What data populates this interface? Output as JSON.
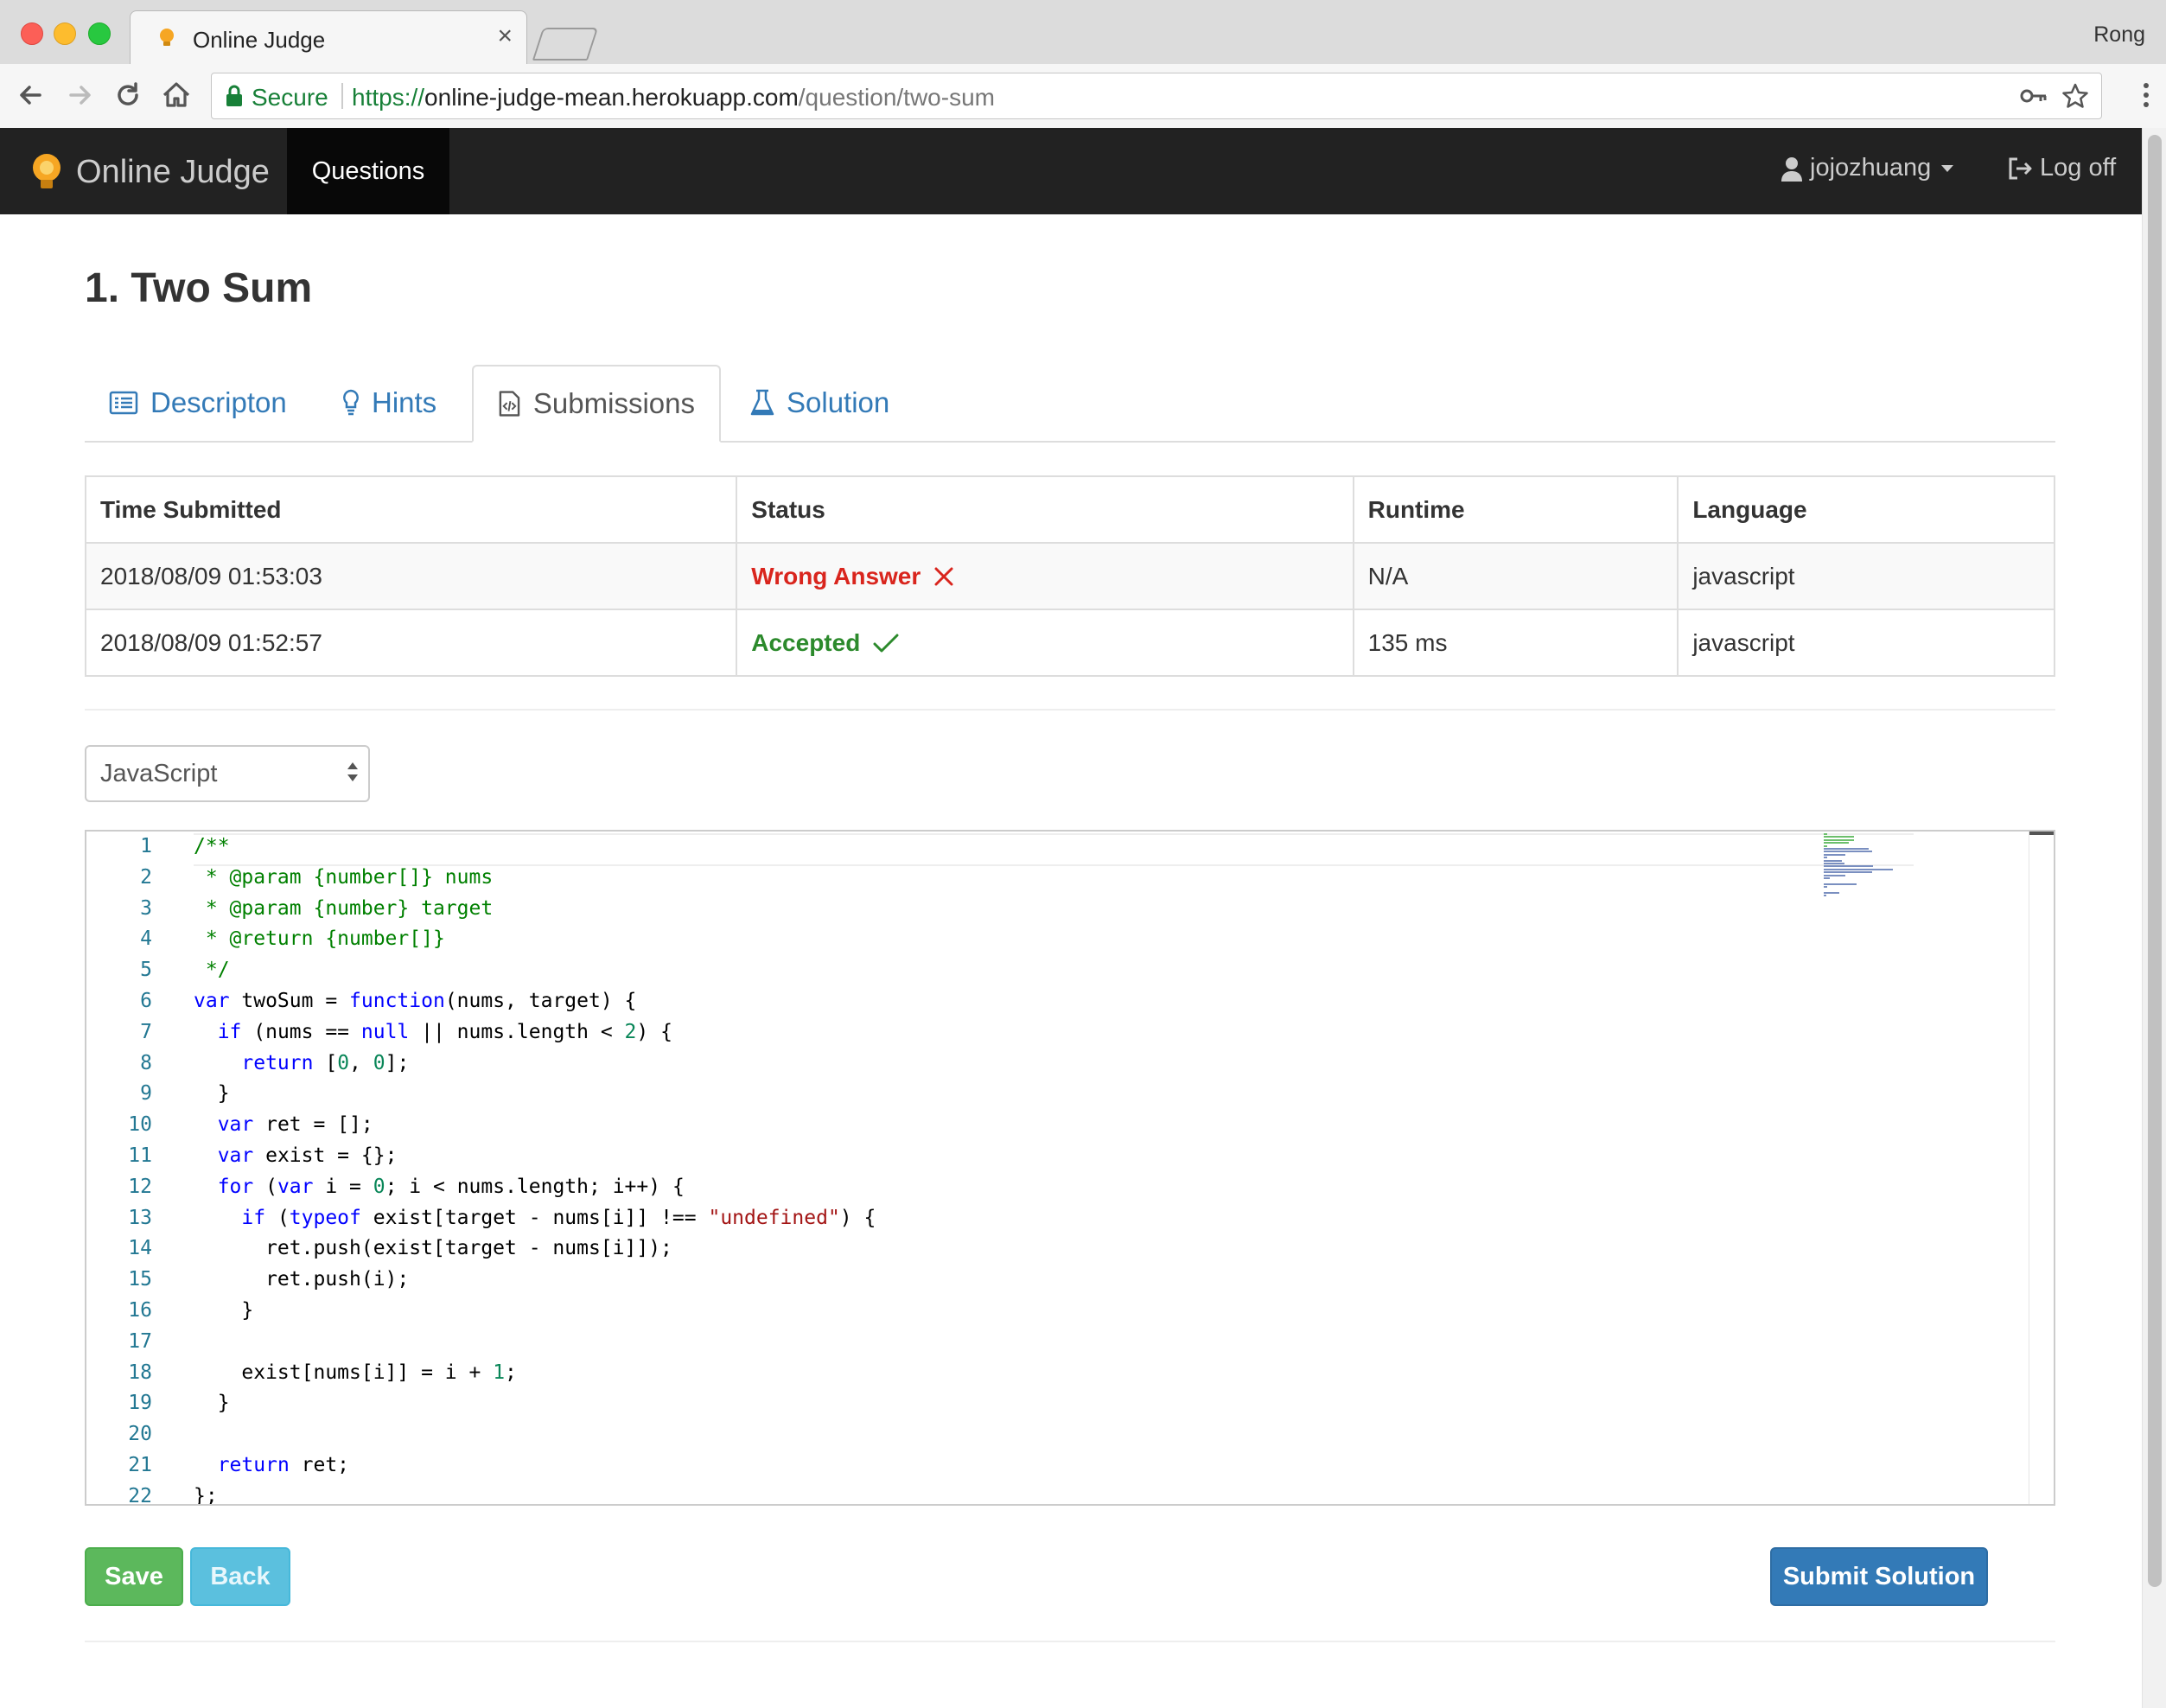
{
  "browser": {
    "tab_title": "Online Judge",
    "profile": "Rong",
    "secure_label": "Secure",
    "url_scheme": "https://",
    "url_host": "online-judge-mean.herokuapp.com",
    "url_path": "/question/two-sum"
  },
  "navbar": {
    "brand": "Online Judge",
    "questions": "Questions",
    "user": "jojozhuang",
    "logoff": "Log off"
  },
  "page": {
    "title": "1. Two Sum"
  },
  "tabs": [
    {
      "label": "Descripton",
      "icon": "list-alt-icon"
    },
    {
      "label": "Hints",
      "icon": "lightbulb-icon"
    },
    {
      "label": "Submissions",
      "icon": "code-file-icon",
      "active": true
    },
    {
      "label": "Solution",
      "icon": "flask-icon"
    }
  ],
  "submissions": {
    "headers": [
      "Time Submitted",
      "Status",
      "Runtime",
      "Language"
    ],
    "rows": [
      {
        "time": "2018/08/09 01:53:03",
        "status": "Wrong Answer",
        "status_type": "wrong",
        "runtime": "N/A",
        "language": "javascript"
      },
      {
        "time": "2018/08/09 01:52:57",
        "status": "Accepted",
        "status_type": "accepted",
        "runtime": "135 ms",
        "language": "javascript"
      }
    ]
  },
  "language_select": {
    "selected": "JavaScript"
  },
  "editor": {
    "line_numbers": [
      "1",
      "2",
      "3",
      "4",
      "5",
      "6",
      "7",
      "8",
      "9",
      "10",
      "11",
      "12",
      "13",
      "14",
      "15",
      "16",
      "17",
      "18",
      "19",
      "20",
      "21",
      "22"
    ],
    "lines": [
      "/**",
      " * @param {number[]} nums",
      " * @param {number} target",
      " * @return {number[]}",
      " */",
      "var twoSum = function(nums, target) {",
      "  if (nums == null || nums.length < 2) {",
      "    return [0, 0];",
      "  }",
      "  var ret = [];",
      "  var exist = {};",
      "  for (var i = 0; i < nums.length; i++) {",
      "    if (typeof exist[target - nums[i]] !== \"undefined\") {",
      "      ret.push(exist[target - nums[i]]);",
      "      ret.push(i);",
      "    }",
      "",
      "    exist[nums[i]] = i + 1;",
      "  }",
      "",
      "  return ret;",
      "};"
    ]
  },
  "buttons": {
    "save": "Save",
    "back": "Back",
    "submit": "Submit Solution"
  },
  "colors": {
    "navbar": "#222222",
    "wrong": "#d9251d",
    "accepted": "#2c8a2c",
    "link": "#337ab7",
    "save": "#5cb85c",
    "back": "#5bc0de",
    "submit": "#337ab7"
  }
}
